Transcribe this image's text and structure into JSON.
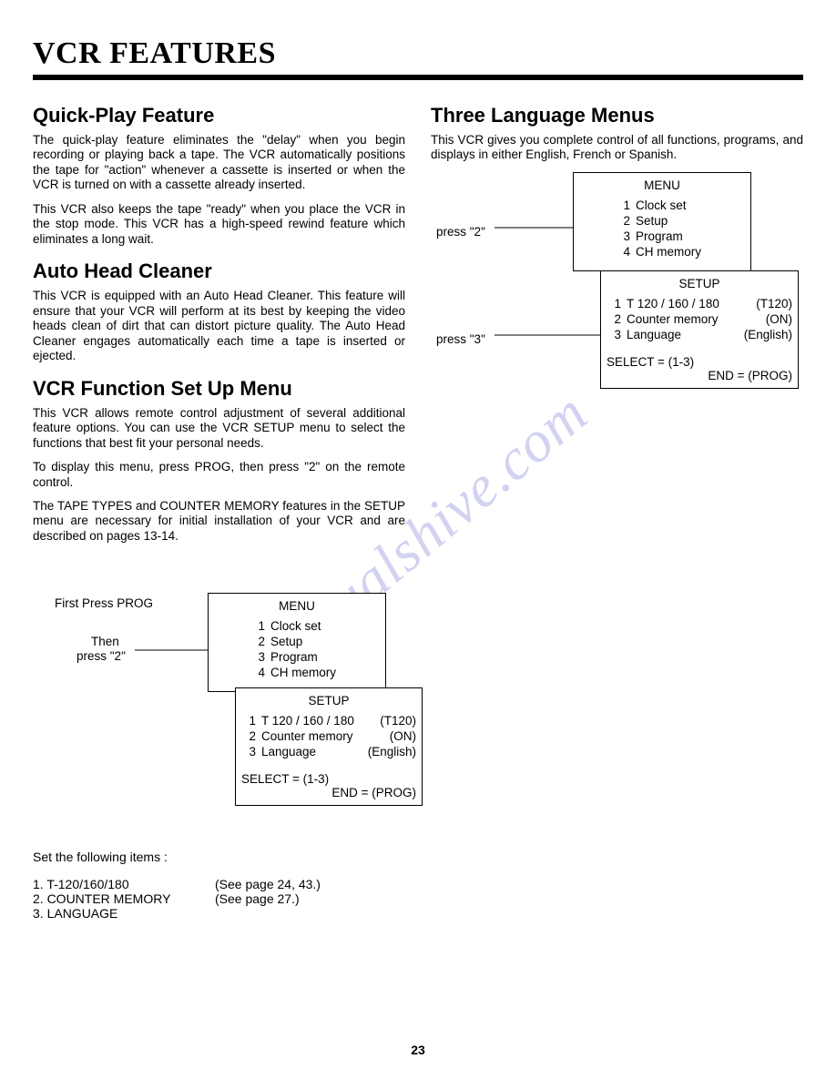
{
  "page": {
    "title": "VCR FEATURES",
    "number": "23",
    "watermark": "manualshive.com"
  },
  "left": {
    "h1": "Quick-Play Feature",
    "p1": "The quick-play feature eliminates the \"delay\" when you begin recording or playing back a tape. The VCR automatically positions the tape for \"action\" whenever a cassette is inserted or when the VCR is turned on with a cassette already inserted.",
    "p1b": "This VCR also keeps the tape \"ready\" when you place the VCR in the stop mode. This VCR has a high-speed rewind feature which eliminates a long wait.",
    "h2": "Auto Head Cleaner",
    "p2": "This VCR is equipped with an Auto Head Cleaner. This feature will ensure that your VCR will perform at its best by keeping the video heads clean of dirt that can distort picture quality. The Auto Head Cleaner engages automatically each time a tape is inserted or ejected.",
    "h3": "VCR Function Set Up Menu",
    "p3": "This VCR allows remote control adjustment of several additional feature options. You can use the VCR SETUP menu to select the functions that best fit your personal needs.",
    "p3b": "To display this menu, press PROG, then press \"2\" on the remote control.",
    "p3c": "The TAPE TYPES and COUNTER MEMORY features in the SETUP menu are necessary for initial installation of your VCR and are described on pages 13-14.",
    "diag": {
      "label_first": "First Press PROG",
      "label_then": "Then",
      "label_press2": "press \"2\""
    },
    "set_items_intro": "Set the following items :",
    "set_items": [
      {
        "label": "1. T-120/160/180",
        "ref": "(See page 24, 43.)"
      },
      {
        "label": "2. COUNTER MEMORY",
        "ref": "(See page 27.)"
      },
      {
        "label": "3. LANGUAGE",
        "ref": ""
      }
    ]
  },
  "right": {
    "h1": "Three Language Menus",
    "p1": "This VCR gives you complete control of all functions, programs, and displays in either English, French or Spanish.",
    "diag": {
      "label_press2": "press \"2\"",
      "label_press3": "press \"3\""
    }
  },
  "menu": {
    "title": "MENU",
    "items": [
      {
        "n": "1",
        "label": "Clock set"
      },
      {
        "n": "2",
        "label": "Setup"
      },
      {
        "n": "3",
        "label": "Program"
      },
      {
        "n": "4",
        "label": "CH memory"
      }
    ]
  },
  "setup": {
    "title": "SETUP",
    "items": [
      {
        "n": "1",
        "label": "T 120 / 160 / 180",
        "val": "(T120)"
      },
      {
        "n": "2",
        "label": "Counter memory",
        "val": "(ON)"
      },
      {
        "n": "3",
        "label": "Language",
        "val": "(English)"
      }
    ],
    "select": "SELECT = (1-3)",
    "end": "END = (PROG)"
  }
}
